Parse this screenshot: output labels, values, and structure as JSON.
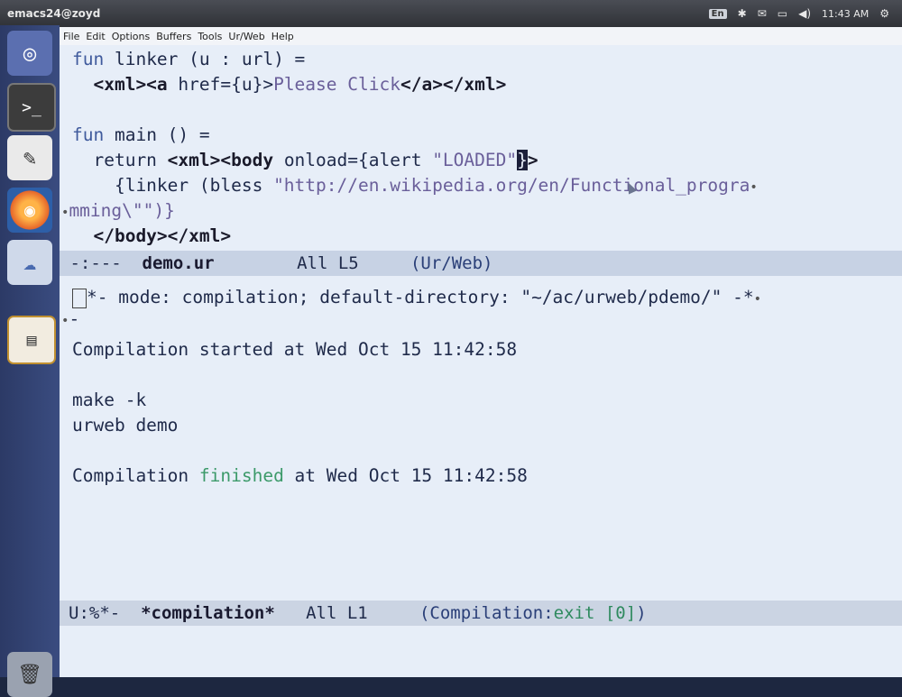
{
  "window_title": "emacs24@zoyd",
  "indicators": {
    "keyboard": "En",
    "clock": "11:43 AM"
  },
  "launcher": {
    "dash_icon": "ubuntu-logo-icon",
    "terminal_icon": ">_",
    "editor_icon": "text-editor-icon",
    "browser_icon": "firefox-icon",
    "cloud_icon": "cloud-icon",
    "emacs_icon": "emacs-icon",
    "trash_icon": "trash-icon"
  },
  "menu": [
    "File",
    "Edit",
    "Options",
    "Buffers",
    "Tools",
    "Ur/Web",
    "Help"
  ],
  "editor": {
    "line1": {
      "kw": "fun",
      "rest": " linker (u : url) ="
    },
    "line2": {
      "indent": "  ",
      "open": "<xml><a",
      "attr": " href={u}>",
      "text": "Please Click",
      "close": "</a></xml>"
    },
    "line3": {
      "kw": "fun",
      "rest": " main () ="
    },
    "line4": {
      "indent": "  return ",
      "open": "<xml><body",
      "attr": " onload={alert ",
      "str": "\"LOADED\"",
      "cursor": "}",
      "close": ">"
    },
    "line5": {
      "indent": "    {linker (bless ",
      "str": "\"http://en.wikipedia.org/en/Functional_progra"
    },
    "line6": {
      "str": "mming\\\"\")}"
    },
    "line7": {
      "indent": "  ",
      "close": "</body></xml>"
    }
  },
  "modeline_top": {
    "status": " -:---  ",
    "buffer": "demo.ur",
    "position": "        All L5     ",
    "mode": "(Ur/Web)"
  },
  "compilation": {
    "header1": "*- mode: compilation; default-directory: \"~/ac/urweb/pdemo/\" -*",
    "header2": "-",
    "started": "Compilation started at Wed Oct 15 11:42:58",
    "cmd1": "make -k",
    "cmd2": "urweb demo",
    "finished_pre": "Compilation ",
    "finished_word": "finished",
    "finished_post": " at Wed Oct 15 11:42:58"
  },
  "modeline_bottom": {
    "status": "U:%*-  ",
    "buffer": "*compilation*",
    "position": "   All L1     ",
    "mode_pre": "(Compilation:",
    "mode_exit": "exit [0]",
    "mode_post": ")"
  }
}
